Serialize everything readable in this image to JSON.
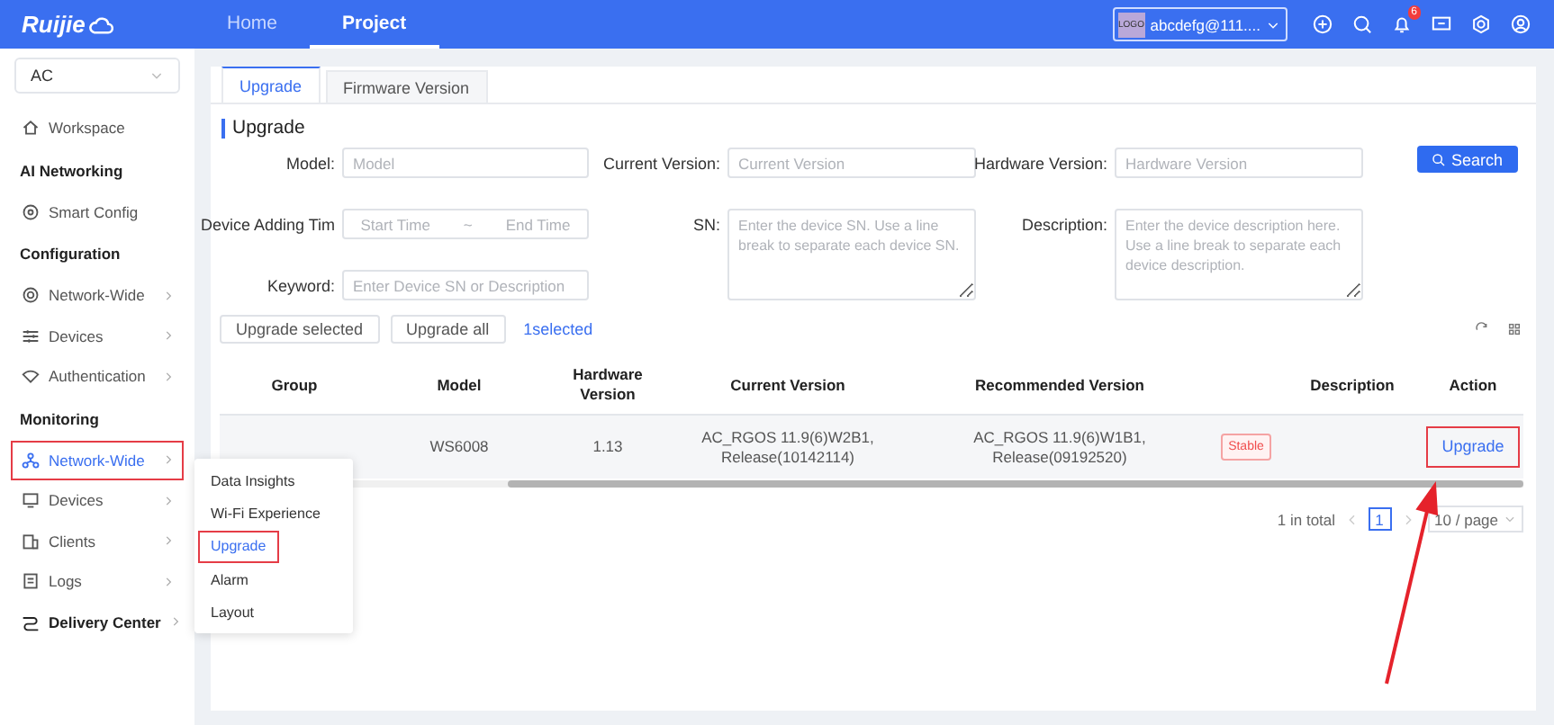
{
  "top_bar": {
    "logo": "Ruijie",
    "nav": [
      {
        "label": "Home",
        "selected": false
      },
      {
        "label": "Project",
        "selected": true
      }
    ],
    "account": {
      "logo_text": "LOGO",
      "name": "abcdefg@111...."
    },
    "notifications_badge": "6"
  },
  "sidebar": {
    "selector": "AC",
    "items": [
      {
        "kind": "item",
        "label": "Workspace",
        "expandable": false,
        "selected": false,
        "highlighted": false
      },
      {
        "kind": "heading",
        "label": "AI Networking"
      },
      {
        "kind": "item",
        "label": "Smart Config",
        "expandable": false,
        "selected": false,
        "highlighted": false
      },
      {
        "kind": "heading",
        "label": "Configuration"
      },
      {
        "kind": "item",
        "label": "Network-Wide",
        "expandable": true,
        "selected": false,
        "highlighted": false
      },
      {
        "kind": "item",
        "label": "Devices",
        "expandable": true,
        "selected": false,
        "highlighted": false
      },
      {
        "kind": "item",
        "label": "Authentication",
        "expandable": true,
        "selected": false,
        "highlighted": false
      },
      {
        "kind": "heading",
        "label": "Monitoring"
      },
      {
        "kind": "item",
        "label": "Network-Wide",
        "expandable": true,
        "selected": true,
        "highlighted": true
      },
      {
        "kind": "item",
        "label": "Devices",
        "expandable": true,
        "selected": false,
        "highlighted": false
      },
      {
        "kind": "item",
        "label": "Clients",
        "expandable": true,
        "selected": false,
        "highlighted": false
      },
      {
        "kind": "item",
        "label": "Logs",
        "expandable": true,
        "selected": false,
        "highlighted": false
      },
      {
        "kind": "section",
        "label": "Delivery Center",
        "expandable": true,
        "selected": false,
        "highlighted": false
      }
    ]
  },
  "submenu": [
    {
      "label": "Data Insights",
      "selected": false,
      "highlighted": false
    },
    {
      "label": "Wi-Fi Experience",
      "selected": false,
      "highlighted": false
    },
    {
      "label": "Upgrade",
      "selected": true,
      "highlighted": true
    },
    {
      "label": "Alarm",
      "selected": false,
      "highlighted": false
    },
    {
      "label": "Layout",
      "selected": false,
      "highlighted": false
    }
  ],
  "tabs": [
    {
      "label": "Upgrade",
      "selected": true
    },
    {
      "label": "Firmware Version",
      "selected": false
    }
  ],
  "section_title": "Upgrade",
  "filters": {
    "model": {
      "label": "Model:",
      "placeholder": "Model"
    },
    "current_version": {
      "label": "Current Version:",
      "placeholder": "Current Version"
    },
    "hardware_version": {
      "label": "Hardware Version:",
      "placeholder": "Hardware Version"
    },
    "device_adding_time": {
      "label": "Device Adding Tim",
      "start_placeholder": "Start Time",
      "separator": "~",
      "end_placeholder": "End Time"
    },
    "sn": {
      "label": "SN:",
      "placeholder": "Enter the device SN. Use a line break to separate each device SN."
    },
    "description": {
      "label": "Description:",
      "placeholder": "Enter the device description here. Use a line break to separate each device description."
    },
    "keyword": {
      "label": "Keyword:",
      "placeholder": "Enter Device SN or Description"
    },
    "search_button": "Search"
  },
  "actions": {
    "buttons": [
      "Upgrade selected",
      "Upgrade all"
    ],
    "selected_count": "1selected"
  },
  "table": {
    "columns": [
      "Group",
      "Model",
      "Hardware Version",
      "Current Version",
      "Recommended Version",
      "",
      "Description",
      "Action"
    ],
    "rows": [
      {
        "model": "WS6008",
        "hardware_version": "1.13",
        "current_version": "AC_RGOS 11.9(6)W2B1, Release(10142114)",
        "recommended_version": "AC_RGOS 11.9(6)W1B1, Release(09192520)",
        "tag": "Stable",
        "action": "Upgrade",
        "action_highlighted": true
      }
    ]
  },
  "pagination": {
    "total": "1 in total",
    "pages": [
      {
        "label": "1",
        "selected": true
      }
    ],
    "page_size": "10 / page"
  }
}
